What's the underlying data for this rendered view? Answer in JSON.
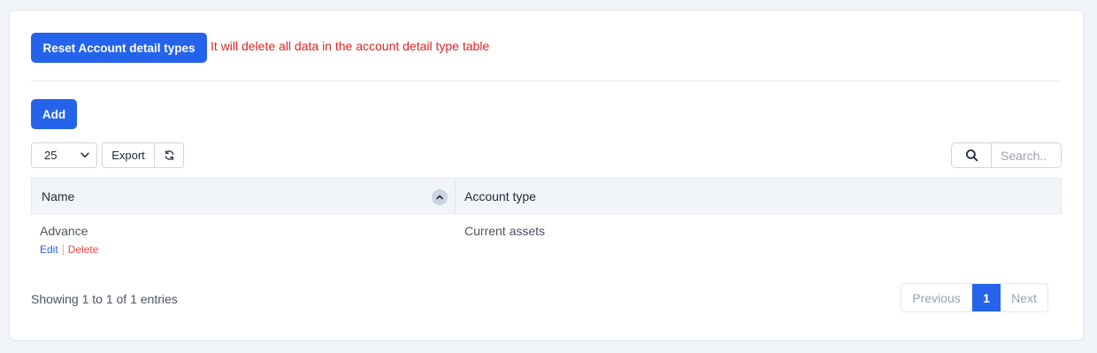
{
  "toolbar": {
    "reset_label": "Reset Account detail types",
    "warning_text": "It will delete all data in the account detail type table",
    "add_label": "Add"
  },
  "controls": {
    "page_length": "25",
    "export_label": "Export",
    "search_placeholder": "Search.."
  },
  "table": {
    "columns": [
      "Name",
      "Account type"
    ],
    "rows": [
      {
        "name": "Advance",
        "account_type": "Current assets",
        "actions": [
          "Edit",
          "Delete"
        ]
      }
    ]
  },
  "footer": {
    "info": "Showing 1 to 1 of 1 entries",
    "pagination": {
      "previous": "Previous",
      "current": "1",
      "next": "Next"
    }
  },
  "colors": {
    "primary": "#2563eb",
    "danger": "#dc2626"
  },
  "icons": {
    "select_arrow": "chevron-down-icon",
    "refresh": "refresh-icon",
    "search": "search-icon",
    "sort": "sort-up-icon"
  }
}
